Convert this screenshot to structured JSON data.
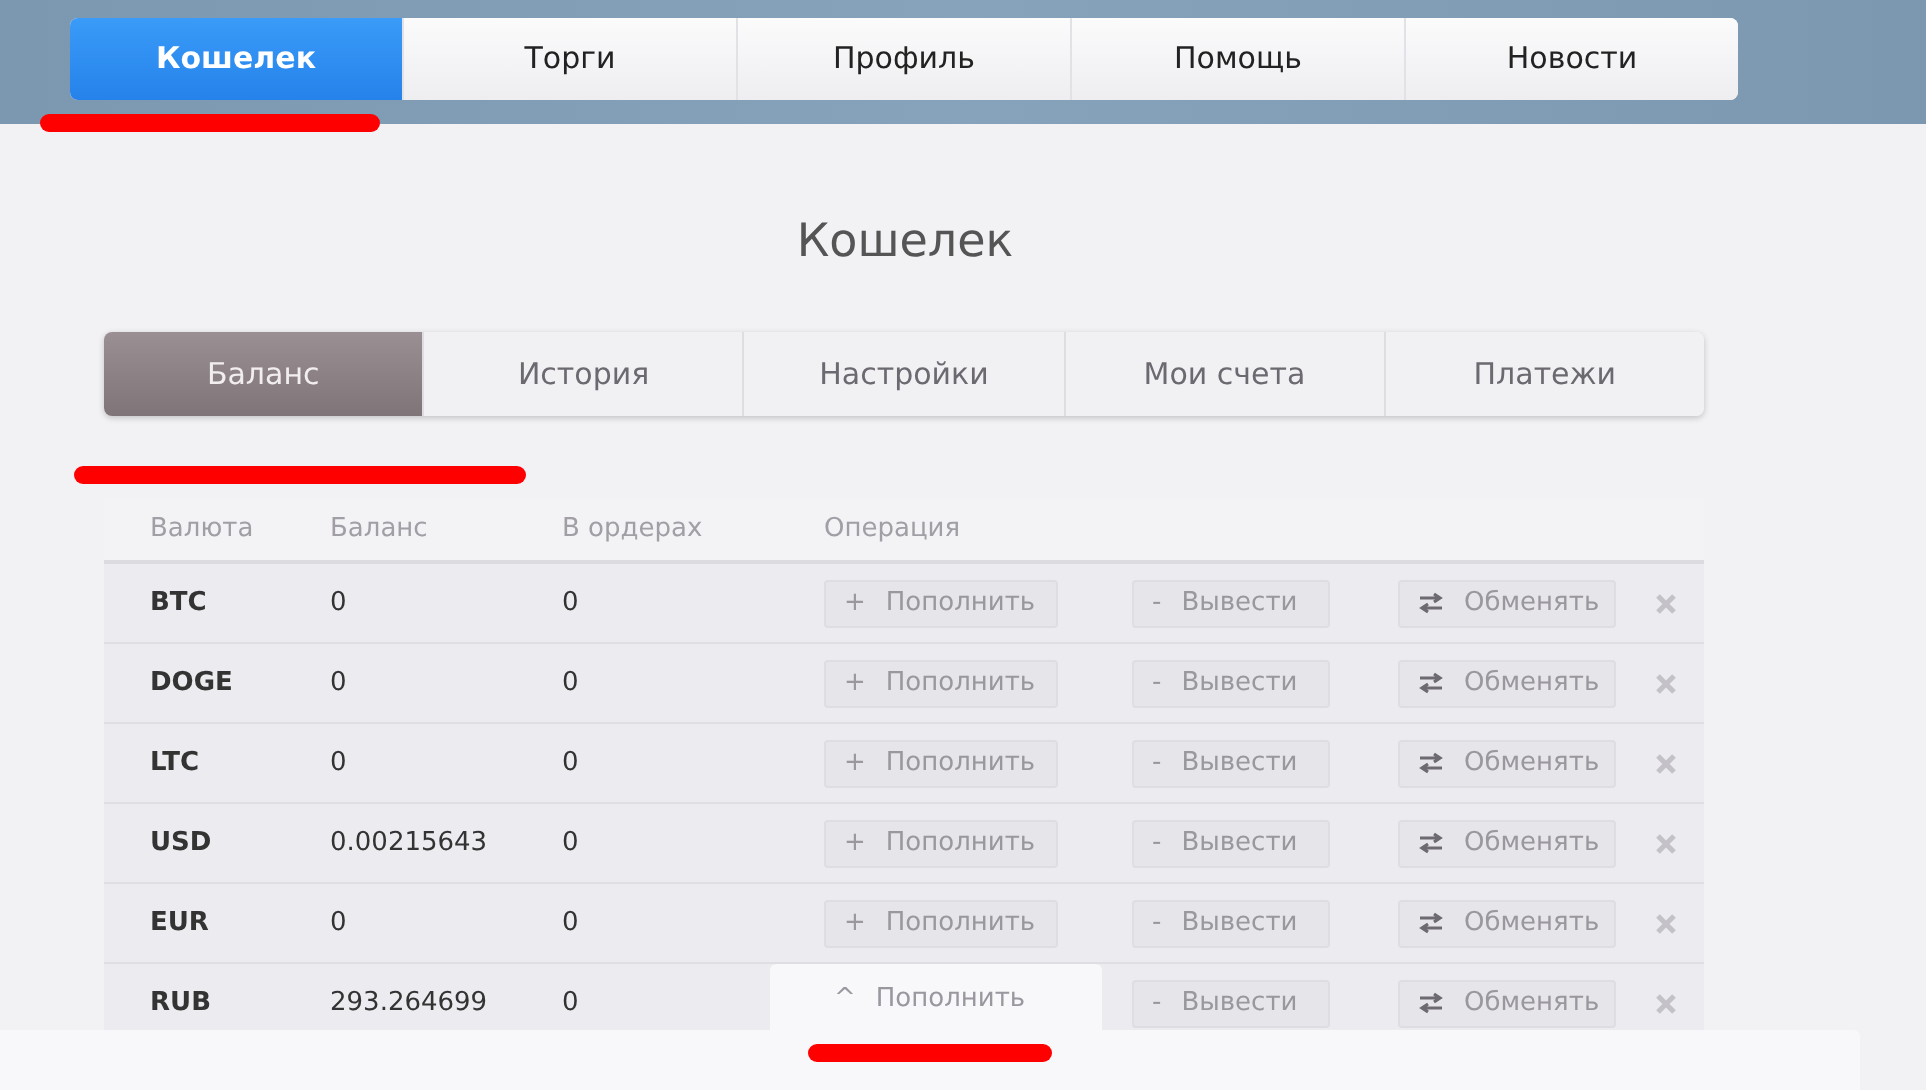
{
  "main_nav": [
    {
      "label": "Кошелек",
      "selected": true,
      "underlined": true
    },
    {
      "label": "Торги",
      "selected": false,
      "underlined": false
    },
    {
      "label": "Профиль",
      "selected": false,
      "underlined": false
    },
    {
      "label": "Помощь",
      "selected": false,
      "underlined": false
    },
    {
      "label": "Новости",
      "selected": false,
      "underlined": false
    }
  ],
  "page_title": "Кошелек",
  "wallet_tabs": [
    {
      "label": "Баланс",
      "selected": true,
      "underlined": true
    },
    {
      "label": "История",
      "selected": false,
      "underlined": false
    },
    {
      "label": "Настройки",
      "selected": false,
      "underlined": false
    },
    {
      "label": "Мои счета",
      "selected": false,
      "underlined": false
    },
    {
      "label": "Платежи",
      "selected": false,
      "underlined": false
    }
  ],
  "table": {
    "columns": [
      "Валюта",
      "Баланс",
      "В ордерах",
      "Операция"
    ],
    "rows": [
      {
        "currency": "BTC",
        "balance": "0",
        "in_orders": "0",
        "deposit": "Пополнить",
        "withdraw": "Вывести",
        "exchange": "Обменять",
        "expanded": false
      },
      {
        "currency": "DOGE",
        "balance": "0",
        "in_orders": "0",
        "deposit": "Пополнить",
        "withdraw": "Вывести",
        "exchange": "Обменять",
        "expanded": false
      },
      {
        "currency": "LTC",
        "balance": "0",
        "in_orders": "0",
        "deposit": "Пополнить",
        "withdraw": "Вывести",
        "exchange": "Обменять",
        "expanded": false
      },
      {
        "currency": "USD",
        "balance": "0.00215643",
        "in_orders": "0",
        "deposit": "Пополнить",
        "withdraw": "Вывести",
        "exchange": "Обменять",
        "expanded": false
      },
      {
        "currency": "EUR",
        "balance": "0",
        "in_orders": "0",
        "deposit": "Пополнить",
        "withdraw": "Вывести",
        "exchange": "Обменять",
        "expanded": false
      },
      {
        "currency": "RUB",
        "balance": "293.264699",
        "in_orders": "0",
        "deposit": "Пополнить",
        "withdraw": "Вывести",
        "exchange": "Обменять",
        "expanded": true
      }
    ]
  },
  "deposit_sign": "+",
  "deposit_open_sign": "^",
  "withdraw_sign": "-"
}
